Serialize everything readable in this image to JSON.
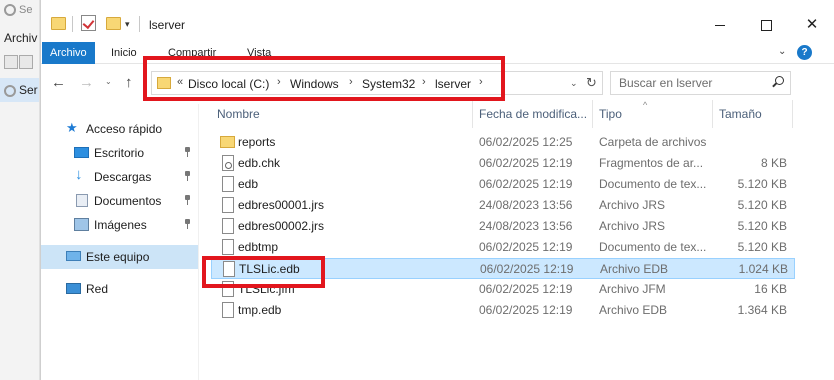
{
  "background_window": {
    "title": "Se",
    "menu": "Archiv",
    "selected_item": "Ser"
  },
  "window": {
    "title": "lserver",
    "controls": {
      "minimize_icon": "minimize-icon",
      "maximize_icon": "maximize-icon",
      "close": "✕"
    }
  },
  "ribbon": {
    "tabs": [
      "Archivo",
      "Inicio",
      "Compartir",
      "Vista"
    ],
    "active_tab": "Archivo",
    "expand": "⌄",
    "help": "?"
  },
  "address": {
    "back": "←",
    "forward": "→",
    "recent": "⌄",
    "up": "↑",
    "overflow": "«",
    "crumbs": [
      "Disco local (C:)",
      "Windows",
      "System32",
      "lserver"
    ],
    "separator": "›",
    "dropdown": "⌄",
    "refresh": "↻"
  },
  "search": {
    "placeholder": "Buscar en lserver"
  },
  "nav": {
    "items": [
      {
        "label": "Acceso rápido",
        "icon": "star-icon"
      },
      {
        "label": "Escritorio",
        "icon": "desktop-icon",
        "pinned": true
      },
      {
        "label": "Descargas",
        "icon": "download-icon",
        "pinned": true
      },
      {
        "label": "Documentos",
        "icon": "documents-icon",
        "pinned": true
      },
      {
        "label": "Imágenes",
        "icon": "pictures-icon",
        "pinned": true
      },
      {
        "label": "Este equipo",
        "icon": "computer-icon",
        "selected": true
      },
      {
        "label": "Red",
        "icon": "network-icon"
      }
    ]
  },
  "columns": {
    "name": "Nombre",
    "date": "Fecha de modifica...",
    "type": "Tipo",
    "size": "Tamaño",
    "sort_indicator": "^"
  },
  "files": [
    {
      "name": "reports",
      "date": "06/02/2025 12:25",
      "type": "Carpeta de archivos",
      "size": "",
      "icon": "folder-icon"
    },
    {
      "name": "edb.chk",
      "date": "06/02/2025 12:19",
      "type": "Fragmentos de ar...",
      "size": "8 KB",
      "icon": "system-file-icon"
    },
    {
      "name": "edb",
      "date": "06/02/2025 12:19",
      "type": "Documento de tex...",
      "size": "5.120 KB",
      "icon": "file-icon"
    },
    {
      "name": "edbres00001.jrs",
      "date": "24/08/2023 13:56",
      "type": "Archivo JRS",
      "size": "5.120 KB",
      "icon": "file-icon"
    },
    {
      "name": "edbres00002.jrs",
      "date": "24/08/2023 13:56",
      "type": "Archivo JRS",
      "size": "5.120 KB",
      "icon": "file-icon"
    },
    {
      "name": "edbtmp",
      "date": "06/02/2025 12:19",
      "type": "Documento de tex...",
      "size": "5.120 KB",
      "icon": "file-icon"
    },
    {
      "name": "TLSLic.edb",
      "date": "06/02/2025 12:19",
      "type": "Archivo EDB",
      "size": "1.024 KB",
      "icon": "file-icon",
      "selected": true
    },
    {
      "name": "TLSLic.jfm",
      "date": "06/02/2025 12:19",
      "type": "Archivo JFM",
      "size": "16 KB",
      "icon": "file-icon"
    },
    {
      "name": "tmp.edb",
      "date": "06/02/2025 12:19",
      "type": "Archivo EDB",
      "size": "1.364 KB",
      "icon": "file-icon"
    }
  ],
  "colors": {
    "accent": "#1979ca",
    "selection": "#cce8ff",
    "highlight_box": "#e2161d",
    "folder": "#f8d775"
  }
}
